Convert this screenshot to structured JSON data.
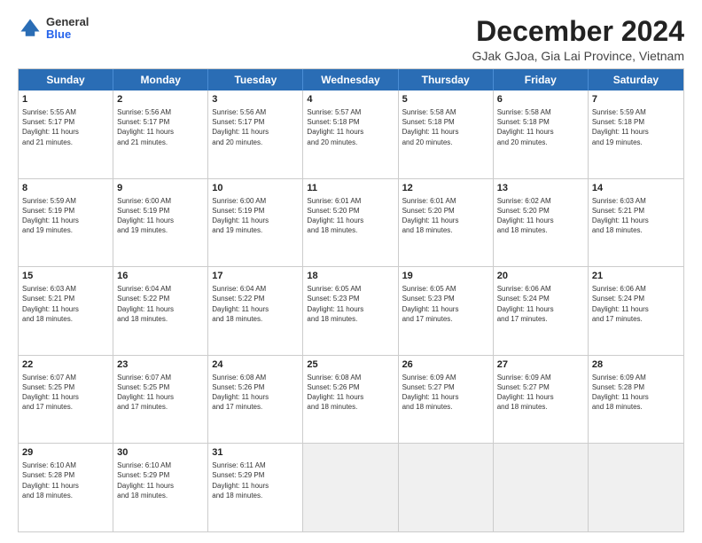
{
  "logo": {
    "general": "General",
    "blue": "Blue"
  },
  "title": "December 2024",
  "subtitle": "GJak GJoa, Gia Lai Province, Vietnam",
  "days": [
    "Sunday",
    "Monday",
    "Tuesday",
    "Wednesday",
    "Thursday",
    "Friday",
    "Saturday"
  ],
  "rows": [
    [
      {
        "day": "1",
        "lines": [
          "Sunrise: 5:55 AM",
          "Sunset: 5:17 PM",
          "Daylight: 11 hours",
          "and 21 minutes."
        ]
      },
      {
        "day": "2",
        "lines": [
          "Sunrise: 5:56 AM",
          "Sunset: 5:17 PM",
          "Daylight: 11 hours",
          "and 21 minutes."
        ]
      },
      {
        "day": "3",
        "lines": [
          "Sunrise: 5:56 AM",
          "Sunset: 5:17 PM",
          "Daylight: 11 hours",
          "and 20 minutes."
        ]
      },
      {
        "day": "4",
        "lines": [
          "Sunrise: 5:57 AM",
          "Sunset: 5:18 PM",
          "Daylight: 11 hours",
          "and 20 minutes."
        ]
      },
      {
        "day": "5",
        "lines": [
          "Sunrise: 5:58 AM",
          "Sunset: 5:18 PM",
          "Daylight: 11 hours",
          "and 20 minutes."
        ]
      },
      {
        "day": "6",
        "lines": [
          "Sunrise: 5:58 AM",
          "Sunset: 5:18 PM",
          "Daylight: 11 hours",
          "and 20 minutes."
        ]
      },
      {
        "day": "7",
        "lines": [
          "Sunrise: 5:59 AM",
          "Sunset: 5:18 PM",
          "Daylight: 11 hours",
          "and 19 minutes."
        ]
      }
    ],
    [
      {
        "day": "8",
        "lines": [
          "Sunrise: 5:59 AM",
          "Sunset: 5:19 PM",
          "Daylight: 11 hours",
          "and 19 minutes."
        ]
      },
      {
        "day": "9",
        "lines": [
          "Sunrise: 6:00 AM",
          "Sunset: 5:19 PM",
          "Daylight: 11 hours",
          "and 19 minutes."
        ]
      },
      {
        "day": "10",
        "lines": [
          "Sunrise: 6:00 AM",
          "Sunset: 5:19 PM",
          "Daylight: 11 hours",
          "and 19 minutes."
        ]
      },
      {
        "day": "11",
        "lines": [
          "Sunrise: 6:01 AM",
          "Sunset: 5:20 PM",
          "Daylight: 11 hours",
          "and 18 minutes."
        ]
      },
      {
        "day": "12",
        "lines": [
          "Sunrise: 6:01 AM",
          "Sunset: 5:20 PM",
          "Daylight: 11 hours",
          "and 18 minutes."
        ]
      },
      {
        "day": "13",
        "lines": [
          "Sunrise: 6:02 AM",
          "Sunset: 5:20 PM",
          "Daylight: 11 hours",
          "and 18 minutes."
        ]
      },
      {
        "day": "14",
        "lines": [
          "Sunrise: 6:03 AM",
          "Sunset: 5:21 PM",
          "Daylight: 11 hours",
          "and 18 minutes."
        ]
      }
    ],
    [
      {
        "day": "15",
        "lines": [
          "Sunrise: 6:03 AM",
          "Sunset: 5:21 PM",
          "Daylight: 11 hours",
          "and 18 minutes."
        ]
      },
      {
        "day": "16",
        "lines": [
          "Sunrise: 6:04 AM",
          "Sunset: 5:22 PM",
          "Daylight: 11 hours",
          "and 18 minutes."
        ]
      },
      {
        "day": "17",
        "lines": [
          "Sunrise: 6:04 AM",
          "Sunset: 5:22 PM",
          "Daylight: 11 hours",
          "and 18 minutes."
        ]
      },
      {
        "day": "18",
        "lines": [
          "Sunrise: 6:05 AM",
          "Sunset: 5:23 PM",
          "Daylight: 11 hours",
          "and 18 minutes."
        ]
      },
      {
        "day": "19",
        "lines": [
          "Sunrise: 6:05 AM",
          "Sunset: 5:23 PM",
          "Daylight: 11 hours",
          "and 17 minutes."
        ]
      },
      {
        "day": "20",
        "lines": [
          "Sunrise: 6:06 AM",
          "Sunset: 5:24 PM",
          "Daylight: 11 hours",
          "and 17 minutes."
        ]
      },
      {
        "day": "21",
        "lines": [
          "Sunrise: 6:06 AM",
          "Sunset: 5:24 PM",
          "Daylight: 11 hours",
          "and 17 minutes."
        ]
      }
    ],
    [
      {
        "day": "22",
        "lines": [
          "Sunrise: 6:07 AM",
          "Sunset: 5:25 PM",
          "Daylight: 11 hours",
          "and 17 minutes."
        ]
      },
      {
        "day": "23",
        "lines": [
          "Sunrise: 6:07 AM",
          "Sunset: 5:25 PM",
          "Daylight: 11 hours",
          "and 17 minutes."
        ]
      },
      {
        "day": "24",
        "lines": [
          "Sunrise: 6:08 AM",
          "Sunset: 5:26 PM",
          "Daylight: 11 hours",
          "and 17 minutes."
        ]
      },
      {
        "day": "25",
        "lines": [
          "Sunrise: 6:08 AM",
          "Sunset: 5:26 PM",
          "Daylight: 11 hours",
          "and 18 minutes."
        ]
      },
      {
        "day": "26",
        "lines": [
          "Sunrise: 6:09 AM",
          "Sunset: 5:27 PM",
          "Daylight: 11 hours",
          "and 18 minutes."
        ]
      },
      {
        "day": "27",
        "lines": [
          "Sunrise: 6:09 AM",
          "Sunset: 5:27 PM",
          "Daylight: 11 hours",
          "and 18 minutes."
        ]
      },
      {
        "day": "28",
        "lines": [
          "Sunrise: 6:09 AM",
          "Sunset: 5:28 PM",
          "Daylight: 11 hours",
          "and 18 minutes."
        ]
      }
    ],
    [
      {
        "day": "29",
        "lines": [
          "Sunrise: 6:10 AM",
          "Sunset: 5:28 PM",
          "Daylight: 11 hours",
          "and 18 minutes."
        ]
      },
      {
        "day": "30",
        "lines": [
          "Sunrise: 6:10 AM",
          "Sunset: 5:29 PM",
          "Daylight: 11 hours",
          "and 18 minutes."
        ]
      },
      {
        "day": "31",
        "lines": [
          "Sunrise: 6:11 AM",
          "Sunset: 5:29 PM",
          "Daylight: 11 hours",
          "and 18 minutes."
        ]
      },
      {
        "day": "",
        "lines": []
      },
      {
        "day": "",
        "lines": []
      },
      {
        "day": "",
        "lines": []
      },
      {
        "day": "",
        "lines": []
      }
    ]
  ]
}
